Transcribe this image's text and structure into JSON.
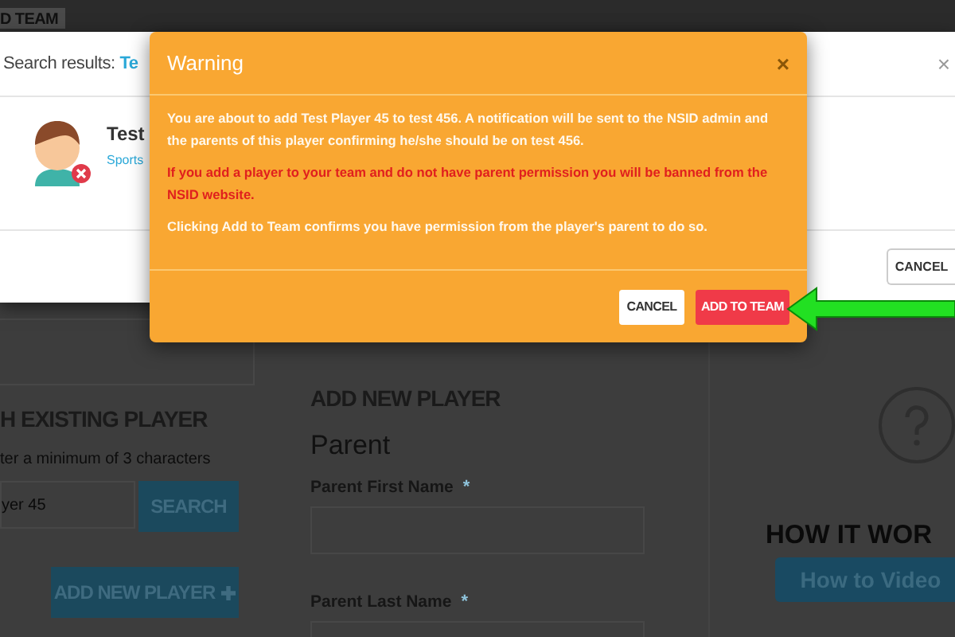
{
  "top_tab": "D TEAM",
  "search_existing": {
    "heading": "H EXISTING PLAYER",
    "hint": "ter a minimum of 3 characters",
    "value": "yer 45",
    "search_button": "SEARCH",
    "add_button": "ADD NEW PLAYER"
  },
  "add_new": {
    "heading": "ADD NEW PLAYER",
    "section": "Parent",
    "fields": [
      {
        "label": "Parent First Name",
        "mark": "*"
      },
      {
        "label": "Parent Last Name",
        "mark": "*"
      }
    ]
  },
  "help": {
    "heading": "HOW IT WOR",
    "button": "How to Video"
  },
  "search_modal": {
    "title_prefix": "Search results: ",
    "title_query": "Te",
    "close": "×",
    "player": {
      "name": "Test",
      "subtitle": "Sports"
    },
    "cancel": "CANCEL"
  },
  "warning": {
    "title": "Warning",
    "close": "×",
    "paragraphs": [
      {
        "kind": "info",
        "text": "You are about to add Test Player 45 to test 456. A notification will be sent to the NSID admin and the parents of this player confirming he/she should be on test 456."
      },
      {
        "kind": "alert",
        "text": "If you add a player to your team and do not have parent permission you will be banned from the NSID website."
      },
      {
        "kind": "info",
        "text": "Clicking Add to Team confirms you have permission from the player's parent to do so."
      }
    ],
    "buttons": [
      {
        "kind": "secondary",
        "label": "CANCEL"
      },
      {
        "kind": "primary",
        "label": "ADD TO TEAM"
      }
    ]
  }
}
